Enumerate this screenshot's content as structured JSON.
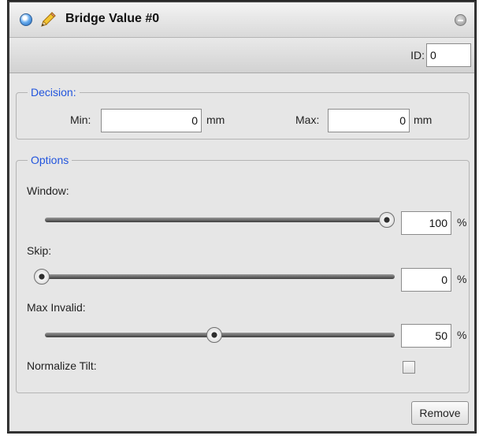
{
  "window": {
    "title": "Bridge Value #0",
    "icons": {
      "status": "blue-orb-icon",
      "edit": "pencil-icon",
      "collapse": "collapse-minus-icon"
    }
  },
  "id_field": {
    "label": "ID:",
    "value": "0"
  },
  "decision": {
    "legend": "Decision:",
    "min": {
      "label": "Min:",
      "value": "0",
      "unit": "mm"
    },
    "max": {
      "label": "Max:",
      "value": "0",
      "unit": "mm"
    }
  },
  "options": {
    "legend": "Options",
    "window": {
      "label": "Window:",
      "value": "100",
      "unit": "%",
      "slider_percent": 100
    },
    "skip": {
      "label": "Skip:",
      "value": "0",
      "unit": "%",
      "slider_percent": 0
    },
    "max_invalid": {
      "label": "Max Invalid:",
      "value": "50",
      "unit": "%",
      "slider_percent": 50
    },
    "normalize_tilt": {
      "label": "Normalize Tilt:",
      "checked": false
    }
  },
  "actions": {
    "remove_label": "Remove"
  },
  "colors": {
    "legend_blue": "#2255dd",
    "panel_bg": "#e6e6e6"
  }
}
